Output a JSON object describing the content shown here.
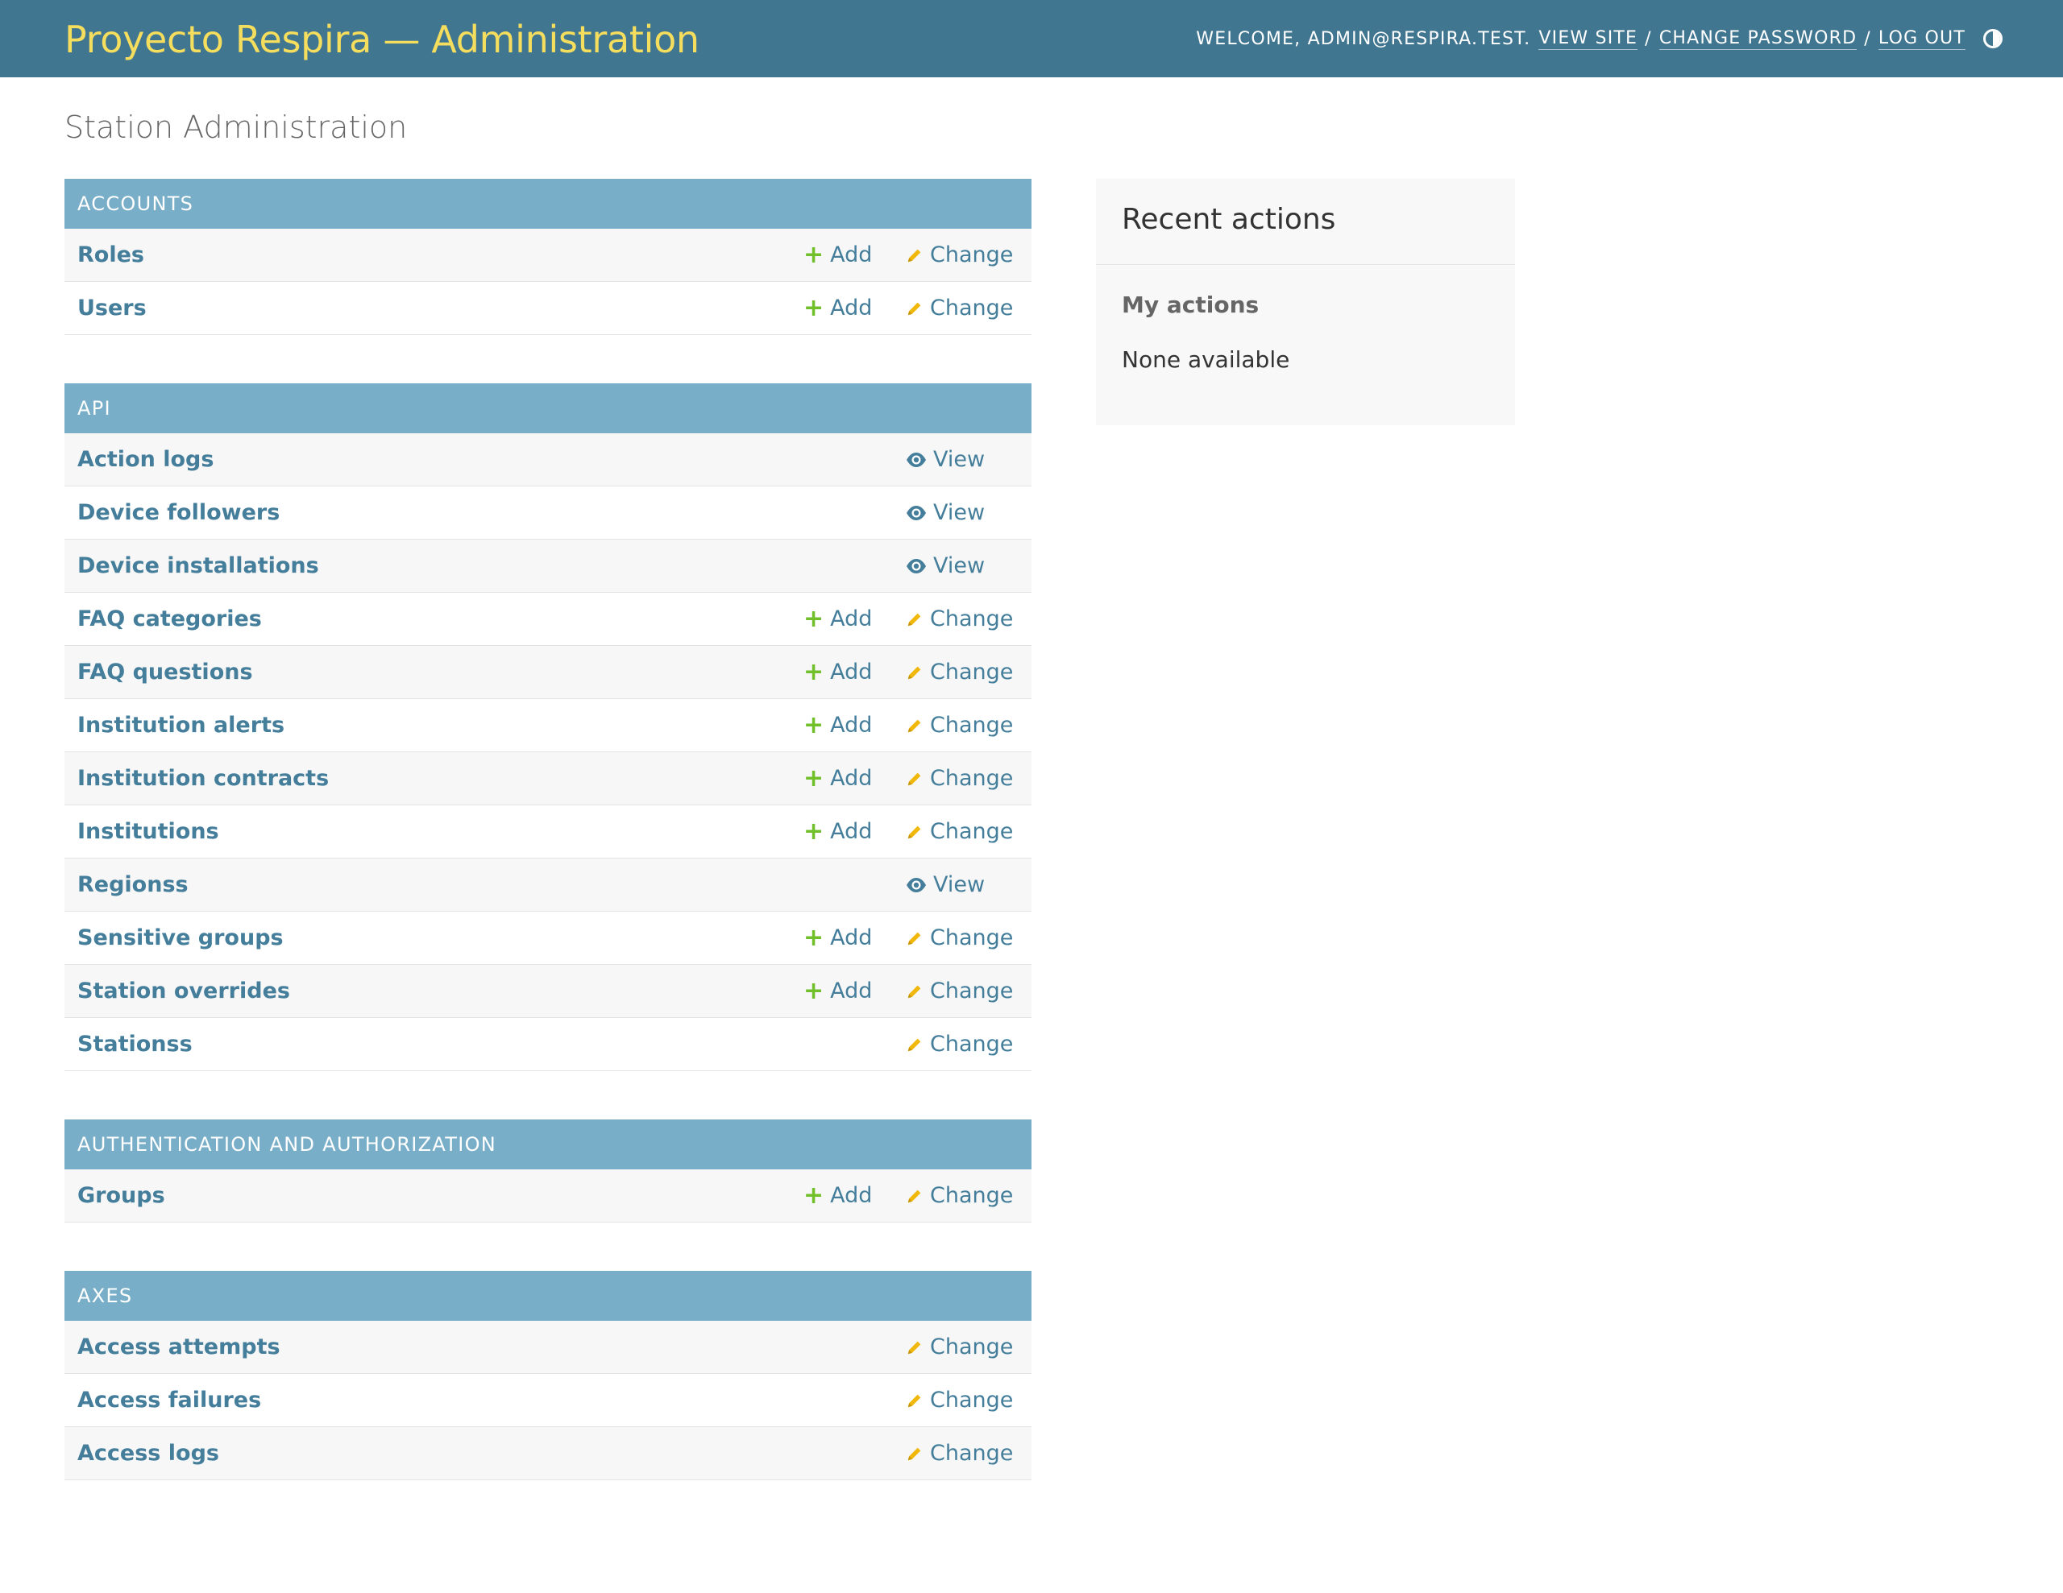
{
  "header": {
    "branding": "Proyecto Respira — Administration",
    "welcome_prefix": "Welcome,",
    "username": "admin@respira.test",
    "welcome_suffix": ".",
    "view_site": "View site",
    "change_password": "Change password",
    "log_out": "Log out",
    "separator": "/",
    "theme_toggle_icon": "half-circle-contrast-icon"
  },
  "page_title": "Station Administration",
  "colors": {
    "header_bg": "#417690",
    "branding": "#f5dd5d",
    "module_caption_bg": "#79aec8",
    "link": "#447e9b",
    "add_icon": "#70bf2b",
    "change_icon": "#efb80b",
    "view_icon": "#447e9b"
  },
  "modules": [
    {
      "caption": "Accounts",
      "models": [
        {
          "name": "Roles",
          "add": "Add",
          "change": "Change"
        },
        {
          "name": "Users",
          "add": "Add",
          "change": "Change"
        }
      ]
    },
    {
      "caption": "API",
      "models": [
        {
          "name": "Action logs",
          "view": "View"
        },
        {
          "name": "Device followers",
          "view": "View"
        },
        {
          "name": "Device installations",
          "view": "View"
        },
        {
          "name": "FAQ categories",
          "add": "Add",
          "change": "Change"
        },
        {
          "name": "FAQ questions",
          "add": "Add",
          "change": "Change"
        },
        {
          "name": "Institution alerts",
          "add": "Add",
          "change": "Change"
        },
        {
          "name": "Institution contracts",
          "add": "Add",
          "change": "Change"
        },
        {
          "name": "Institutions",
          "add": "Add",
          "change": "Change"
        },
        {
          "name": "Regionss",
          "view": "View"
        },
        {
          "name": "Sensitive groups",
          "add": "Add",
          "change": "Change"
        },
        {
          "name": "Station overrides",
          "add": "Add",
          "change": "Change"
        },
        {
          "name": "Stationss",
          "change": "Change"
        }
      ]
    },
    {
      "caption": "Authentication and Authorization",
      "models": [
        {
          "name": "Groups",
          "add": "Add",
          "change": "Change"
        }
      ]
    },
    {
      "caption": "Axes",
      "models": [
        {
          "name": "Access attempts",
          "change": "Change"
        },
        {
          "name": "Access failures",
          "change": "Change"
        },
        {
          "name": "Access logs",
          "change": "Change"
        }
      ]
    }
  ],
  "recent_actions": {
    "title": "Recent actions",
    "subtitle": "My actions",
    "empty_text": "None available"
  }
}
